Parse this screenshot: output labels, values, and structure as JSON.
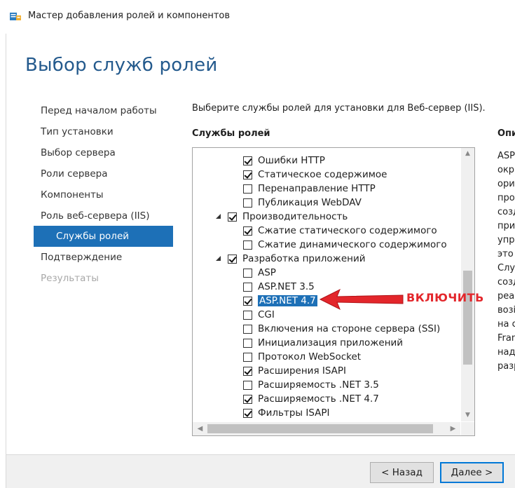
{
  "window": {
    "title": "Мастер добавления ролей и компонентов",
    "icon": "server-manager-icon"
  },
  "page_title": "Выбор служб ролей",
  "nav": {
    "items": [
      {
        "label": "Перед началом работы",
        "state": "normal"
      },
      {
        "label": "Тип установки",
        "state": "normal"
      },
      {
        "label": "Выбор сервера",
        "state": "normal"
      },
      {
        "label": "Роли сервера",
        "state": "normal"
      },
      {
        "label": "Компоненты",
        "state": "normal"
      },
      {
        "label": "Роль веб-сервера (IIS)",
        "state": "normal"
      },
      {
        "label": "Службы ролей",
        "state": "selected"
      },
      {
        "label": "Подтверждение",
        "state": "normal"
      },
      {
        "label": "Результаты",
        "state": "disabled"
      }
    ]
  },
  "prompt": "Выберите службы ролей для установки для Веб-сервер (IIS).",
  "services_header": "Службы ролей",
  "description_header": "Опи",
  "tree": [
    {
      "label": "Ошибки HTTP",
      "checked": true,
      "level": 2
    },
    {
      "label": "Статическое содержимое",
      "checked": true,
      "level": 2
    },
    {
      "label": "Перенаправление HTTP",
      "checked": false,
      "level": 2
    },
    {
      "label": "Публикация WebDAV",
      "checked": false,
      "level": 2
    },
    {
      "label": "Производительность",
      "checked": true,
      "level": 1,
      "expanded": true
    },
    {
      "label": "Сжатие статического содержимого",
      "checked": true,
      "level": 2
    },
    {
      "label": "Сжатие динамического содержимого",
      "checked": false,
      "level": 2
    },
    {
      "label": "Разработка приложений",
      "checked": true,
      "level": 1,
      "expanded": true
    },
    {
      "label": "ASP",
      "checked": false,
      "level": 2
    },
    {
      "label": "ASP.NET 3.5",
      "checked": false,
      "level": 2
    },
    {
      "label": "ASP.NET 4.7",
      "checked": true,
      "level": 2,
      "highlighted": true
    },
    {
      "label": "CGI",
      "checked": false,
      "level": 2
    },
    {
      "label": "Включения на стороне сервера (SSI)",
      "checked": false,
      "level": 2
    },
    {
      "label": "Инициализация приложений",
      "checked": false,
      "level": 2
    },
    {
      "label": "Протокол WebSocket",
      "checked": false,
      "level": 2
    },
    {
      "label": "Расширения ISAPI",
      "checked": true,
      "level": 2
    },
    {
      "label": "Расширяемость .NET 3.5",
      "checked": false,
      "level": 2
    },
    {
      "label": "Расширяемость .NET 4.7",
      "checked": true,
      "level": 2
    },
    {
      "label": "Фильтры ISAPI",
      "checked": true,
      "level": 2
    }
  ],
  "description_lines": [
    "ASP",
    "окр",
    "ори",
    "про",
    "созд",
    "при",
    "упр",
    "это",
    "Слу",
    "созд",
    "реа",
    "возі",
    "на с",
    "Fran",
    "над",
    "разр"
  ],
  "annotation": {
    "text": "ВКЛЮЧИТЬ",
    "color": "#e3262b"
  },
  "buttons": {
    "back": "< Назад",
    "next": "Далее >"
  },
  "colors": {
    "selection": "#1d70b7",
    "title": "#245a8d"
  }
}
